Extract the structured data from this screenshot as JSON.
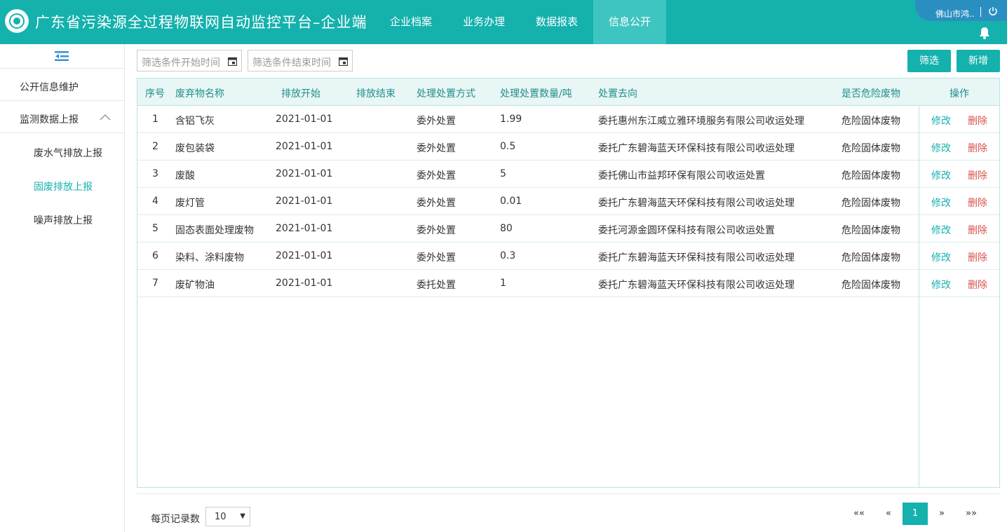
{
  "header": {
    "title": "广东省污染源全过程物联网自动监控平台–企业端",
    "nav": [
      "企业档案",
      "业务办理",
      "数据报表",
      "信息公开"
    ],
    "active_nav": "信息公开",
    "user_name": "佛山市鸿..",
    "icons": [
      "logo-emblem",
      "power-icon",
      "bell-icon"
    ]
  },
  "sidebar": {
    "items": [
      {
        "label": "公开信息维护"
      },
      {
        "label": "监测数据上报",
        "expanded": true
      }
    ],
    "subitems": [
      {
        "label": "废水气排放上报"
      },
      {
        "label": "固废排放上报",
        "active": true
      },
      {
        "label": "噪声排放上报"
      }
    ]
  },
  "filters": {
    "start_placeholder": "筛选条件开始时间",
    "end_placeholder": "筛选条件结束时间",
    "filter_button": "筛选",
    "add_button": "新增"
  },
  "table": {
    "headers": [
      "序号",
      "废弃物名称",
      "排放开始",
      "排放结束",
      "处理处置方式",
      "处理处置数量/吨",
      "处置去向",
      "是否危险废物",
      "操作"
    ],
    "edit_label": "修改",
    "delete_label": "删除",
    "rows": [
      {
        "no": "1",
        "name": "含铝飞灰",
        "start": "2021-01-01",
        "end": "",
        "method": "委外处置",
        "qty": "1.99",
        "dest": "委托惠州东江威立雅环境服务有限公司收运处理",
        "hazard": "危险固体废物"
      },
      {
        "no": "2",
        "name": "废包装袋",
        "start": "2021-01-01",
        "end": "",
        "method": "委外处置",
        "qty": "0.5",
        "dest": "委托广东碧海蓝天环保科技有限公司收运处理",
        "hazard": "危险固体废物"
      },
      {
        "no": "3",
        "name": "废酸",
        "start": "2021-01-01",
        "end": "",
        "method": "委外处置",
        "qty": "5",
        "dest": "委托佛山市益邦环保有限公司收运处置",
        "hazard": "危险固体废物"
      },
      {
        "no": "4",
        "name": "废灯管",
        "start": "2021-01-01",
        "end": "",
        "method": "委外处置",
        "qty": "0.01",
        "dest": "委托广东碧海蓝天环保科技有限公司收运处理",
        "hazard": "危险固体废物"
      },
      {
        "no": "5",
        "name": "固态表面处理废物",
        "start": "2021-01-01",
        "end": "",
        "method": "委外处置",
        "qty": "80",
        "dest": "委托河源金圆环保科技有限公司收运处置",
        "hazard": "危险固体废物"
      },
      {
        "no": "6",
        "name": "染料、涂料废物",
        "start": "2021-01-01",
        "end": "",
        "method": "委外处置",
        "qty": "0.3",
        "dest": "委托广东碧海蓝天环保科技有限公司收运处理",
        "hazard": "危险固体废物"
      },
      {
        "no": "7",
        "name": "废矿物油",
        "start": "2021-01-01",
        "end": "",
        "method": "委托处置",
        "qty": "1",
        "dest": "委托广东碧海蓝天环保科技有限公司收运处理",
        "hazard": "危险固体废物"
      }
    ]
  },
  "pagination": {
    "page_size_label": "每页记录数",
    "page_size": "10",
    "first": "««",
    "prev": "«",
    "current": "1",
    "next": "»",
    "last": "»»"
  },
  "colors": {
    "primary": "#14b1ad",
    "nav_active": "#3fc5c1",
    "user_pill": "#2a8fc0",
    "delete": "#d9534f"
  }
}
